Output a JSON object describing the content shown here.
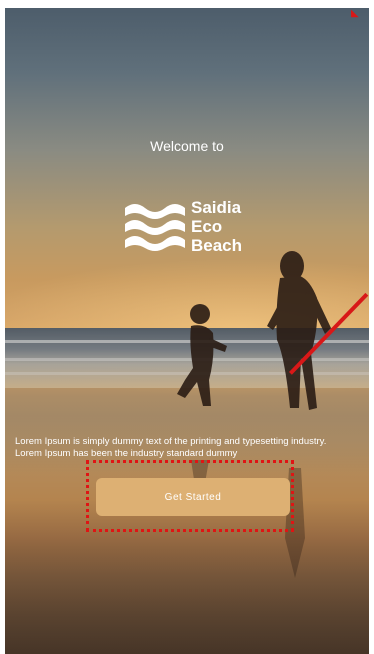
{
  "welcome_text": "Welcome to",
  "brand": {
    "line1": "Saidia",
    "line2": "Eco",
    "line3": "Beach"
  },
  "description": "Lorem Ipsum is simply dummy text of the printing and typesetting industry. Lorem Ipsum has been the industry standard dummy",
  "cta_label": "Get Started",
  "colors": {
    "cta_background": "#ddb073",
    "highlight": "#e01414",
    "text": "#ffffff"
  }
}
